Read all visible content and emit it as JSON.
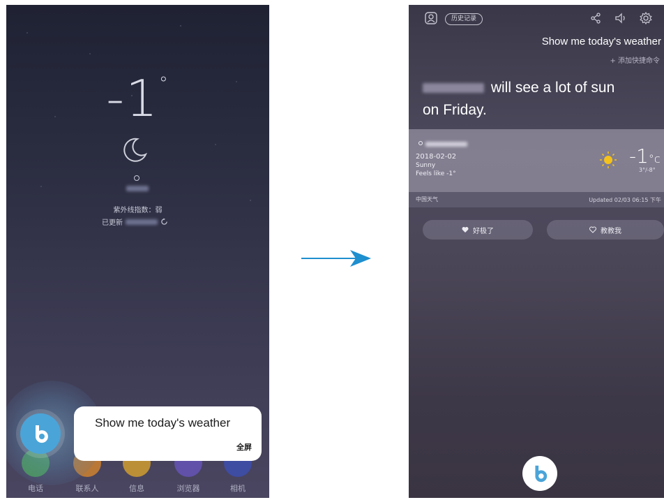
{
  "left_screen": {
    "temperature": "-1",
    "degree_symbol": "°",
    "uv_index": "紫外线指数：弱",
    "updated_label": "已更新",
    "query_text": "Show me today's weather",
    "fullscreen_label": "全屏",
    "dock": [
      {
        "label": "电话",
        "icon": "phone-icon",
        "color": "#4caf50"
      },
      {
        "label": "联系人",
        "icon": "contacts-icon",
        "color": "#e08a2a"
      },
      {
        "label": "信息",
        "icon": "messages-icon",
        "color": "#e0a82a"
      },
      {
        "label": "浏览器",
        "icon": "browser-icon",
        "color": "#6a55c2"
      },
      {
        "label": "相机",
        "icon": "camera-icon",
        "color": "#3b4fb8"
      }
    ]
  },
  "right_screen": {
    "history_label": "历史记录",
    "query_text": "Show me today's weather",
    "add_shortcut": "+ 添加快捷命令",
    "answer_line1": "will see a lot of sun",
    "answer_line2": "on Friday.",
    "weather": {
      "date": "2018-02-02",
      "condition": "Sunny",
      "feels_like": "Feels like -1°",
      "temperature": "-1",
      "unit": "°c",
      "range": "3°/-8°"
    },
    "source_label": "中国天气",
    "updated_text": "Updated 02/03 06:15 下午",
    "like_label": "好极了",
    "teach_label": "教教我"
  },
  "colors": {
    "bixby_blue": "#4aa4d8",
    "arrow_blue": "#1e8fcf",
    "sun_yellow": "#f4c21a"
  }
}
